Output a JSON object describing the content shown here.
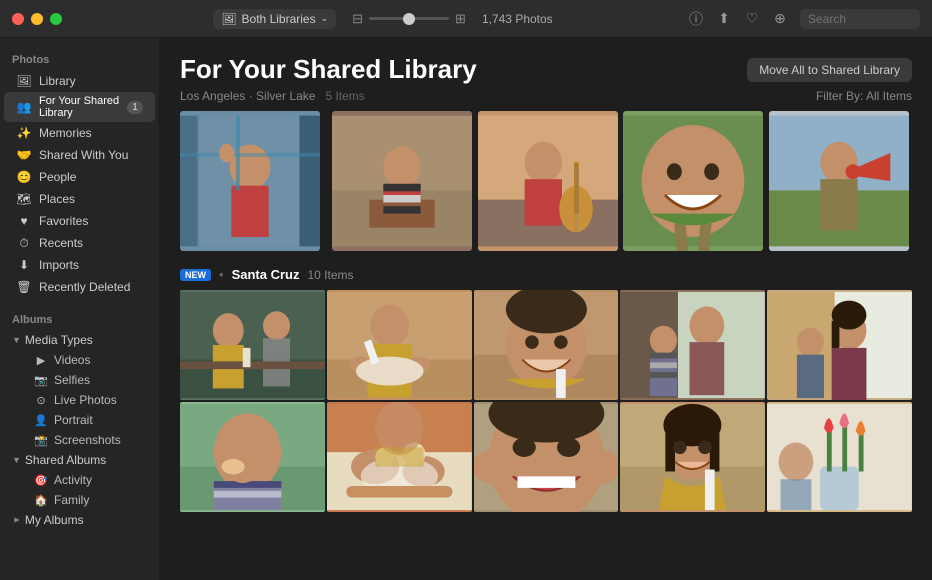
{
  "titlebar": {
    "lib_switcher": "Both Libraries",
    "photo_count": "1,743 Photos",
    "search_placeholder": "Search"
  },
  "sidebar": {
    "photos_section": "Photos",
    "items": [
      {
        "id": "library",
        "label": "Library",
        "icon": "🖼",
        "badge": null
      },
      {
        "id": "for-your-shared-library",
        "label": "For Your Shared Library",
        "icon": "👥",
        "badge": "1",
        "active": true
      },
      {
        "id": "memories",
        "label": "Memories",
        "icon": "✨",
        "badge": null
      },
      {
        "id": "shared-with-you",
        "label": "Shared With You",
        "icon": "🤝",
        "badge": null
      },
      {
        "id": "people",
        "label": "People",
        "icon": "😊",
        "badge": null
      },
      {
        "id": "places",
        "label": "Places",
        "icon": "🗺",
        "badge": null
      },
      {
        "id": "favorites",
        "label": "Favorites",
        "icon": "♥",
        "badge": null
      },
      {
        "id": "recents",
        "label": "Recents",
        "icon": "⏱",
        "badge": null
      },
      {
        "id": "imports",
        "label": "Imports",
        "icon": "⬇",
        "badge": null
      },
      {
        "id": "recently-deleted",
        "label": "Recently Deleted",
        "icon": "🗑",
        "badge": null
      }
    ],
    "albums_section": "Albums",
    "album_groups": [
      {
        "id": "media-types",
        "label": "Media Types",
        "expanded": true,
        "children": [
          {
            "id": "videos",
            "label": "Videos",
            "icon": "▶"
          },
          {
            "id": "selfies",
            "label": "Selfies",
            "icon": "📷"
          },
          {
            "id": "live-photos",
            "label": "Live Photos",
            "icon": "⊙"
          },
          {
            "id": "portrait",
            "label": "Portrait",
            "icon": "👤"
          },
          {
            "id": "screenshots",
            "label": "Screenshots",
            "icon": "📸"
          }
        ]
      },
      {
        "id": "shared-albums",
        "label": "Shared Albums",
        "expanded": true,
        "children": [
          {
            "id": "activity",
            "label": "Activity",
            "icon": "🎯"
          },
          {
            "id": "family",
            "label": "Family",
            "icon": "🏠"
          }
        ]
      },
      {
        "id": "my-albums",
        "label": "My Albums",
        "expanded": false,
        "children": []
      }
    ]
  },
  "content": {
    "page_title": "For Your Shared Library",
    "move_btn_label": "Move All to Shared Library",
    "filter_label": "Filter By: All Items",
    "sections": [
      {
        "id": "los-angeles",
        "location": "Los Angeles · Silver Lake",
        "item_count": "5 Items",
        "photos": [
          {
            "id": "la1",
            "color": "#7a9db5"
          },
          {
            "id": "la2",
            "color": "#8b7060"
          },
          {
            "id": "la3",
            "color": "#c49a6a"
          },
          {
            "id": "la4",
            "color": "#7a9e60"
          },
          {
            "id": "la5",
            "color": "#b8c0c8"
          }
        ]
      },
      {
        "id": "santa-cruz",
        "is_new": true,
        "location": "Santa Cruz",
        "item_count": "10 Items",
        "photos": [
          {
            "id": "sc1",
            "color": "#5a7060"
          },
          {
            "id": "sc2",
            "color": "#c49060"
          },
          {
            "id": "sc3",
            "color": "#b89060"
          },
          {
            "id": "sc4",
            "color": "#8a6e58"
          },
          {
            "id": "sc5",
            "color": "#c4a880"
          },
          {
            "id": "sc6",
            "color": "#8ab890"
          },
          {
            "id": "sc7",
            "color": "#c87850"
          },
          {
            "id": "sc8",
            "color": "#a09070"
          },
          {
            "id": "sc9",
            "color": "#c4906a"
          },
          {
            "id": "sc10",
            "color": "#d4b888"
          },
          {
            "id": "sc11",
            "color": "#706050"
          },
          {
            "id": "sc12",
            "color": "#f0a060"
          },
          {
            "id": "sc13",
            "color": "#909ea8"
          },
          {
            "id": "sc14",
            "color": "#c8a870"
          },
          {
            "id": "sc15",
            "color": "#607870"
          }
        ]
      }
    ]
  }
}
